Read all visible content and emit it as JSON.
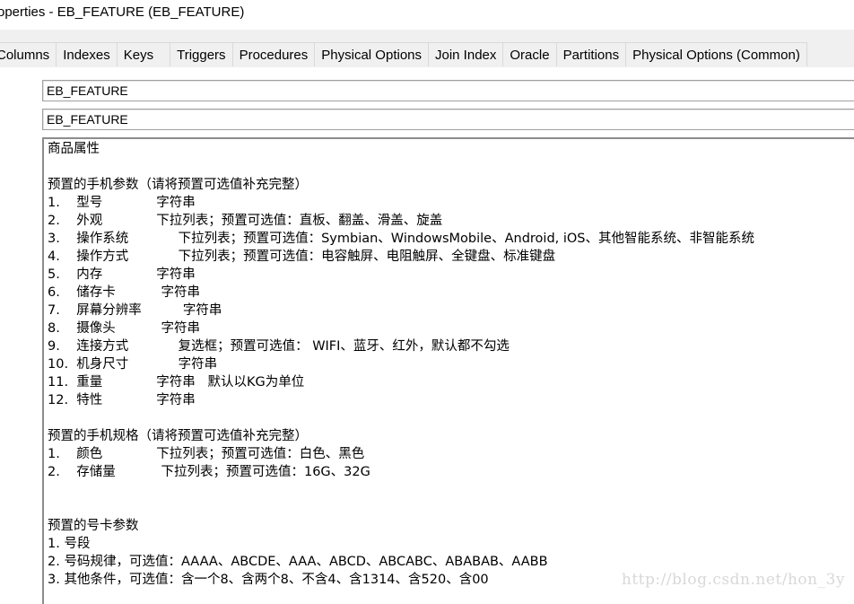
{
  "window": {
    "title": "operties - EB_FEATURE (EB_FEATURE)"
  },
  "tabs": [
    {
      "label": "Columns"
    },
    {
      "label": "Indexes"
    },
    {
      "label": "Keys"
    },
    {
      "label": "Triggers"
    },
    {
      "label": "Procedures"
    },
    {
      "label": "Physical Options"
    },
    {
      "label": "Join Index"
    },
    {
      "label": "Oracle"
    },
    {
      "label": "Partitions"
    },
    {
      "label": "Physical Options (Common)"
    }
  ],
  "fields": {
    "name": "EB_FEATURE",
    "code": "EB_FEATURE"
  },
  "comment_lines": [
    "商品属性",
    "",
    "预置的手机参数（请将预置可选值补充完整）",
    "1.    型号             字符串",
    "2.    外观             下拉列表；预置可选值：直板、翻盖、滑盖、旋盖",
    "3.    操作系统            下拉列表；预置可选值：Symbian、WindowsMobile、Android, iOS、其他智能系统、非智能系统",
    "4.    操作方式            下拉列表；预置可选值：电容触屏、电阻触屏、全键盘、标准键盘",
    "5.    内存             字符串",
    "6.    储存卡           字符串",
    "7.    屏幕分辨率          字符串",
    "8.    摄像头           字符串",
    "9.    连接方式            复选框；预置可选值： WIFI、蓝牙、红外，默认都不勾选",
    "10.  机身尺寸            字符串",
    "11.  重量             字符串   默认以KG为单位",
    "12.  特性             字符串",
    "",
    "预置的手机规格（请将预置可选值补充完整）",
    "1.    颜色             下拉列表；预置可选值：白色、黑色",
    "2.    存储量           下拉列表；预置可选值：16G、32G",
    "",
    "",
    "预置的号卡参数",
    "1. 号段",
    "2. 号码规律，可选值：AAAA、ABCDE、AAA、ABCD、ABCABC、ABABAB、AABB",
    "3. 其他条件，可选值：含一个8、含两个8、不含4、含1314、含520、含00"
  ],
  "watermark": "http://blog.csdn.net/hon_3y"
}
